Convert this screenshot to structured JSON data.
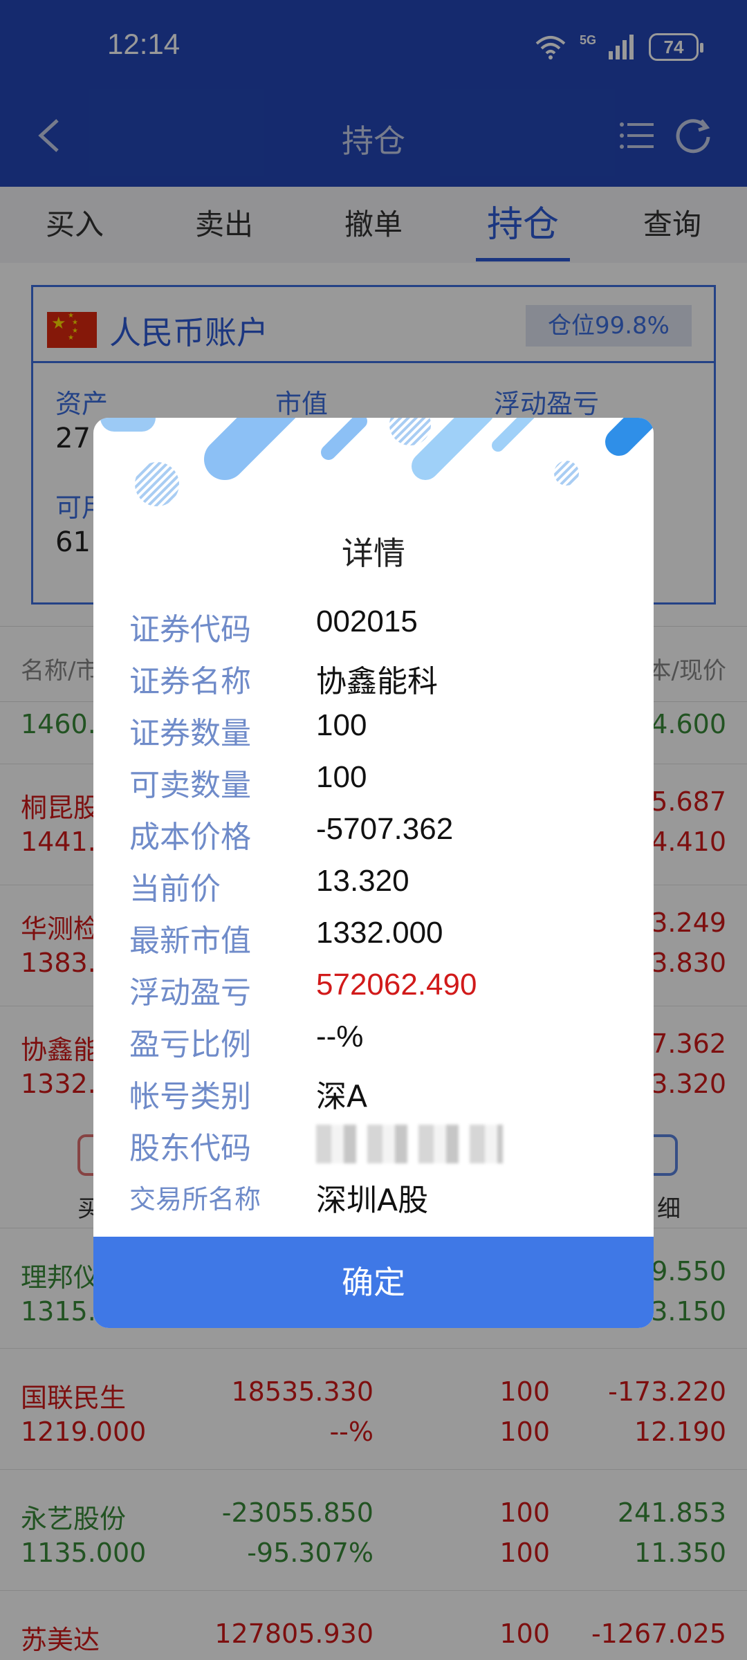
{
  "status": {
    "time": "12:14",
    "network": "5G",
    "battery": "74"
  },
  "nav": {
    "title": "持仓"
  },
  "tabs": [
    {
      "label": "买入"
    },
    {
      "label": "卖出"
    },
    {
      "label": "撤单"
    },
    {
      "label": "持仓"
    },
    {
      "label": "查询"
    }
  ],
  "account": {
    "title": "人民币账户",
    "position_badge": "仓位99.8%",
    "labels": {
      "assets": "资产",
      "market_value": "市值",
      "float_pl": "浮动盈亏",
      "available": "可用"
    },
    "values": {
      "assets_partial": "27",
      "available_partial": "61"
    }
  },
  "list": {
    "header_left": "名称/市",
    "header_right": "本/现价",
    "rows": [
      {
        "name": "",
        "sub": "1460.",
        "r1": "",
        "r2": "4.600",
        "color": "green"
      },
      {
        "name": "桐昆股",
        "sub": "1441.",
        "r1": "5.687",
        "r2": "4.410",
        "color": "red"
      },
      {
        "name": "华测检",
        "sub": "1383.",
        "r1": "3.249",
        "r2": "3.830",
        "color": "red"
      },
      {
        "name": "协鑫能",
        "sub": "1332.",
        "r1": "7.362",
        "r2": "3.320",
        "color": "red"
      },
      {
        "name": "理邦仪",
        "sub": "1315.",
        "r1": "9.550",
        "r2": "3.150",
        "color": "green"
      }
    ],
    "full_rows": [
      {
        "name": "国联民生",
        "mv": "1219.000",
        "pl": "18535.330",
        "plpct": "--%",
        "q1": "100",
        "q2": "100",
        "cost": "-173.220",
        "price": "12.190",
        "color": "red"
      },
      {
        "name": "永艺股份",
        "mv": "1135.000",
        "pl": "-23055.850",
        "plpct": "-95.307%",
        "q1": "100",
        "q2": "100",
        "cost": "241.853",
        "price": "11.350",
        "color": "green"
      },
      {
        "name": "苏美达",
        "mv": "",
        "pl": "127805.930",
        "plpct": "",
        "q1": "100",
        "q2": "",
        "cost": "-1267.025",
        "price": "",
        "color": "red"
      }
    ],
    "actions": {
      "left": "买",
      "right": "细"
    }
  },
  "dialog": {
    "title": "详情",
    "rows": [
      {
        "label": "证券代码",
        "value": "002015"
      },
      {
        "label": "证券名称",
        "value": "协鑫能科"
      },
      {
        "label": "证券数量",
        "value": "100"
      },
      {
        "label": "可卖数量",
        "value": "100"
      },
      {
        "label": "成本价格",
        "value": "-5707.362"
      },
      {
        "label": "当前价",
        "value": "13.320"
      },
      {
        "label": "最新市值",
        "value": "1332.000"
      },
      {
        "label": "浮动盈亏",
        "value": "572062.490"
      },
      {
        "label": "盈亏比例",
        "value": "--%"
      },
      {
        "label": "帐号类别",
        "value": "深A"
      },
      {
        "label": "股东代码",
        "value": ""
      },
      {
        "label": "交易所名称",
        "value": "深圳A股"
      }
    ],
    "confirm_label": "确定"
  },
  "colors": {
    "brand": "#2347b8",
    "accent": "#3f78e6",
    "profit": "#d11a1a",
    "loss": "#3a8a3a",
    "label": "#6f8bc9"
  }
}
